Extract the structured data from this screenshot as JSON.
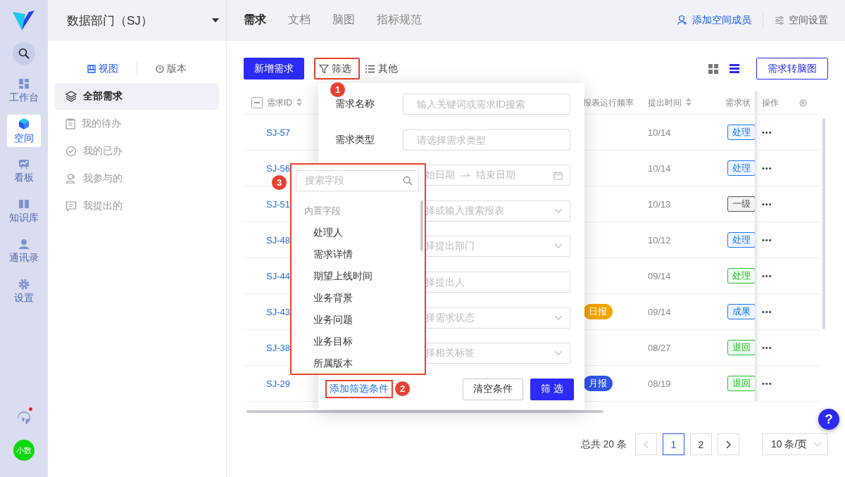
{
  "rail": {
    "items": [
      {
        "label": "工作台",
        "selected": false
      },
      {
        "label": "空间",
        "selected": true
      },
      {
        "label": "看板",
        "selected": false
      },
      {
        "label": "知识库",
        "selected": false
      },
      {
        "label": "通讯录",
        "selected": false
      },
      {
        "label": "设置",
        "selected": false
      }
    ],
    "notification": true,
    "avatar": "小数"
  },
  "space": {
    "name": "数据部门（SJ）",
    "views": [
      {
        "label": "视图",
        "selected": true
      },
      {
        "label": "版本",
        "selected": false
      }
    ],
    "nav": [
      {
        "label": "全部需求",
        "selected": true
      },
      {
        "label": "我的待办",
        "selected": false
      },
      {
        "label": "我的已办",
        "selected": false
      },
      {
        "label": "我参与的",
        "selected": false
      },
      {
        "label": "我提出的",
        "selected": false
      }
    ]
  },
  "header": {
    "tabs": [
      {
        "label": "需求",
        "selected": true
      },
      {
        "label": "文档",
        "selected": false
      },
      {
        "label": "脑图",
        "selected": false
      },
      {
        "label": "指标规范",
        "selected": false
      }
    ],
    "actions": [
      {
        "label": "添加空间成员",
        "kind": "primary"
      },
      {
        "label": "空间设置",
        "kind": "plain"
      }
    ]
  },
  "toolbar": {
    "new_button": "新增需求",
    "filter_button": {
      "label": "筛选",
      "highlighted": true
    },
    "other_button": "其他",
    "view_modes": [
      {
        "kind": "grid",
        "selected": false
      },
      {
        "kind": "list",
        "selected": true
      }
    ],
    "mindmap_button": "需求转脑图"
  },
  "table": {
    "select_all_indeterminate": true,
    "columns": [
      {
        "label": "需求ID",
        "sortable": true
      },
      {
        "label": "报表运行频率",
        "sortable": false
      },
      {
        "label": "提出时间",
        "sortable": true
      },
      {
        "label": "需求状",
        "sortable": false
      },
      {
        "label": "操作",
        "sortable": false
      }
    ],
    "rows": [
      {
        "id": "SJ-57",
        "time": "10/14",
        "status": {
          "text": "处理",
          "color": "#1677ff"
        }
      },
      {
        "id": "SJ-56",
        "time": "10/14",
        "status": {
          "text": "处理",
          "color": "#1677ff"
        }
      },
      {
        "id": "SJ-51",
        "time": "10/13",
        "status": {
          "text": "一级",
          "color": "#555555"
        }
      },
      {
        "id": "SJ-48",
        "time": "10/12",
        "status": {
          "text": "处理",
          "color": "#1677ff"
        }
      },
      {
        "id": "SJ-44",
        "time": "09/14",
        "status": {
          "text": "处理",
          "color": "#22c02a"
        }
      },
      {
        "id": "SJ-43",
        "frequency": {
          "text": "日报",
          "color": "#f5a300"
        },
        "time": "09/14",
        "status": {
          "text": "成果",
          "color": "#1677ff"
        }
      },
      {
        "id": "SJ-38",
        "time": "08/27",
        "status": {
          "text": "退回",
          "color": "#22c02a"
        }
      },
      {
        "id": "SJ-29",
        "frequency": {
          "text": "月报",
          "color": "#2f54eb"
        },
        "time": "08/19",
        "status": {
          "text": "退回",
          "color": "#22c02a"
        }
      }
    ],
    "more": "•••"
  },
  "pagination": {
    "total": "总共 20 条",
    "prev_disabled": true,
    "pages": [
      {
        "label": "1",
        "selected": true
      },
      {
        "label": "2",
        "selected": false
      }
    ],
    "page_size": "10 条/页"
  },
  "filter_popover": {
    "fields": [
      {
        "kind": "text",
        "label": "需求名称",
        "placeholder": "输入关键词或需求ID搜索"
      },
      {
        "kind": "text",
        "label": "需求类型",
        "placeholder": "请选择需求类型"
      },
      {
        "kind": "date_range",
        "start_placeholder": "始日期",
        "end_placeholder": "结束日期"
      },
      {
        "kind": "select",
        "placeholder": "择或输入搜索报表"
      },
      {
        "kind": "select",
        "placeholder": "择提出部门"
      },
      {
        "kind": "text",
        "placeholder": "择提出人"
      },
      {
        "kind": "select",
        "placeholder": "择需求状态"
      },
      {
        "kind": "select",
        "placeholder": "择相关标签"
      }
    ],
    "add_link": {
      "label": "添加筛选条件",
      "highlighted": true
    },
    "clear_button": "清空条件",
    "submit_button": "筛 选"
  },
  "field_dropdown": {
    "highlighted": true,
    "placeholder": "搜索字段",
    "group": "内置字段",
    "items": [
      "处理人",
      "需求详情",
      "期望上线时间",
      "业务背景",
      "业务问题",
      "业务目标",
      "所属版本"
    ]
  },
  "annotations": [
    {
      "label": "1"
    },
    {
      "label": "2"
    },
    {
      "label": "3"
    }
  ],
  "help_button": "?"
}
